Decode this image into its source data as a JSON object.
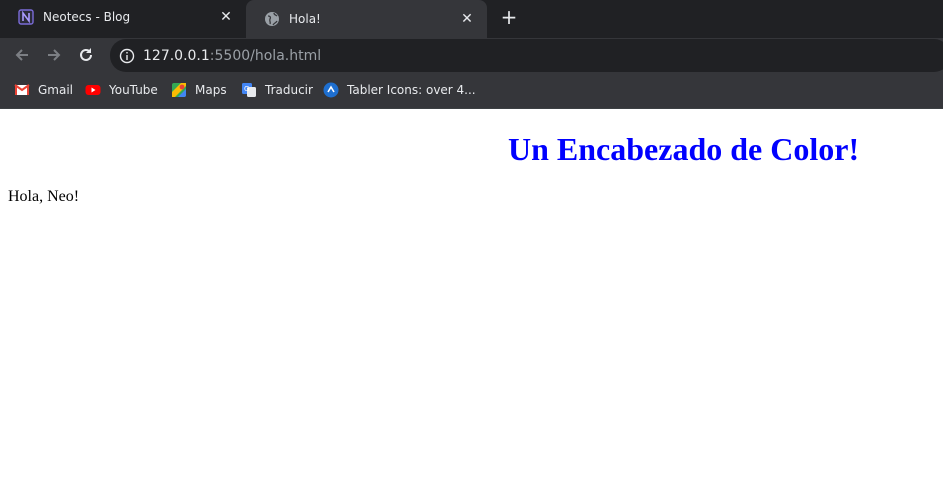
{
  "browser": {
    "tabs": [
      {
        "title": "Neotecs - Blog",
        "active": false,
        "icon": "notion-icon"
      },
      {
        "title": "Hola!",
        "active": true,
        "icon": "globe-icon"
      }
    ],
    "new_tab_label": "+",
    "close_glyph": "✕",
    "url_host": "127.0.0.1",
    "url_rest": ":5500/hola.html",
    "bookmarks": [
      {
        "label": "Gmail",
        "icon": "gmail-icon"
      },
      {
        "label": "YouTube",
        "icon": "youtube-icon"
      },
      {
        "label": "Maps",
        "icon": "maps-icon"
      },
      {
        "label": "Traducir",
        "icon": "translate-icon"
      },
      {
        "label": "Tabler Icons: over 4...",
        "icon": "tabler-icon"
      }
    ]
  },
  "page": {
    "heading": "Un Encabezado de Color!",
    "heading_color": "#0000ff",
    "paragraph": "Hola, Neo!"
  },
  "colors": {
    "tabbar": "#202124",
    "toolbar": "#35363a",
    "omnibox": "#202124"
  }
}
